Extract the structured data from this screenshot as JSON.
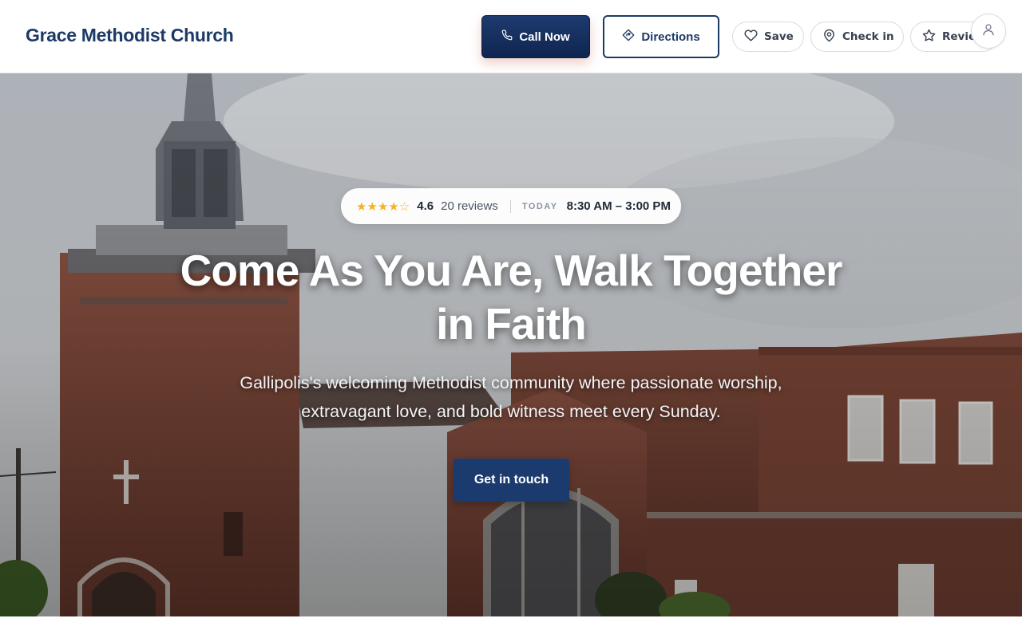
{
  "header": {
    "brand": "Grace Methodist Church",
    "call_label": "Call Now",
    "directions_label": "Directions",
    "save_label": "Save",
    "checkin_label": "Check in",
    "review_label": "Review"
  },
  "hero": {
    "rating": {
      "stars": "★★★★☆",
      "value": "4.6",
      "reviews": "20 reviews",
      "today_label": "TODAY",
      "hours": "8:30 AM – 3:00 PM"
    },
    "headline_line1": "Come As You Are, Walk Together",
    "headline_line2": "in Faith",
    "subline_line1": "Gallipolis's welcoming Methodist community where passionate worship,",
    "subline_line2": "extravagant love, and bold witness meet every Sunday.",
    "cta_label": "Get in touch"
  },
  "icons": {
    "call": "phone-icon",
    "directions": "directions-icon",
    "save": "heart-icon",
    "checkin": "map-pin-icon",
    "review": "star-icon",
    "account": "user-icon"
  },
  "colors": {
    "brand": "#1d3a66",
    "primary_button": "#1b3b6e",
    "star": "#f5b324"
  }
}
